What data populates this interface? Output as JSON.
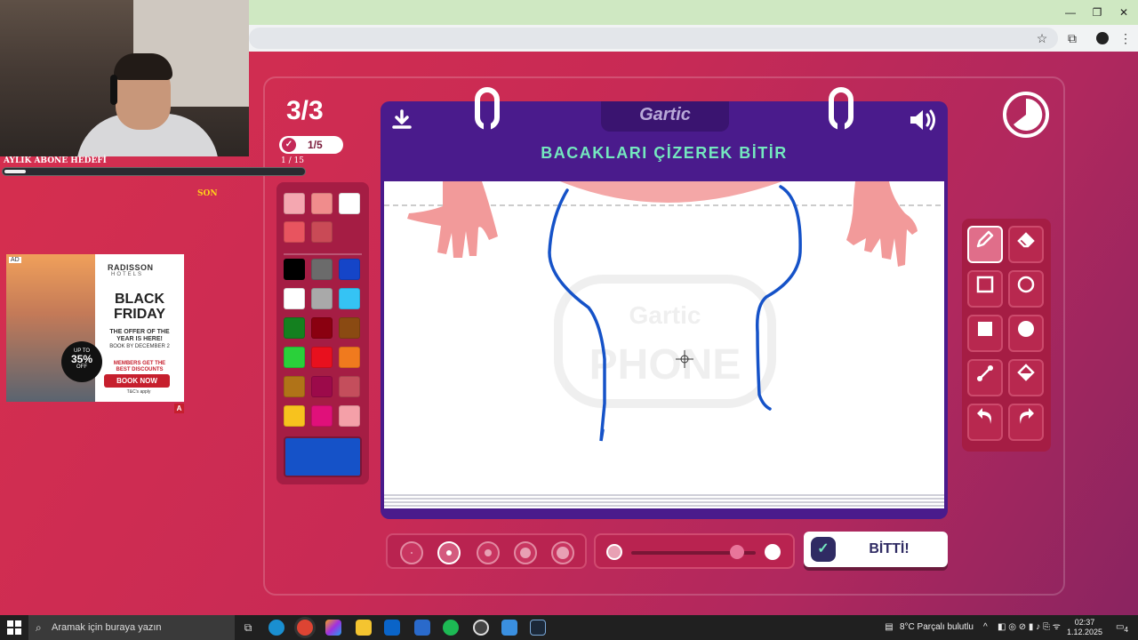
{
  "window": {
    "minimize": "—",
    "restore": "❐",
    "close": "✕"
  },
  "stream": {
    "sub_goal_label": "AYLIK ABONE HEDEFİ",
    "sub_goal_count": "1 / 15",
    "sub_goal_progress": 0.07,
    "son_label": "SON"
  },
  "ad": {
    "tag": "AD",
    "brand": "RADISSON",
    "brand_sub": "HOTELS",
    "title_line1": "BLACK",
    "title_line2": "FRIDAY",
    "offer_line1": "THE OFFER OF THE",
    "offer_line2": "YEAR IS HERE!",
    "book_by": "BOOK BY DECEMBER 2",
    "members_line1": "MEMBERS GET THE",
    "members_line2": "BEST DISCOUNTS",
    "badge_top": "UP TO",
    "badge_value": "35%",
    "badge_bottom": "OFF",
    "cta": "BOOK NOW",
    "terms": "T&C's apply",
    "corner": "A"
  },
  "game": {
    "round": "3/3",
    "sub_round": "1/5",
    "logo": "Gartic",
    "prompt": "BACAKLARI ÇİZEREK BİTİR",
    "done_label": "BİTTİ!",
    "watermark_top": "Gartic",
    "watermark_bottom": "PHONE"
  },
  "palette": {
    "colors": [
      "#f4a7b0",
      "#f08c8c",
      "#ffffff",
      "#e8545f",
      "#c94a56",
      "#000000",
      "#6b6b6b",
      "#1545c8",
      "#ffffff",
      "#a9a9a9",
      "#35c3f4",
      "#14801f",
      "#8a0010",
      "#8a4a12",
      "#2ad03a",
      "#e8101e",
      "#f07a1e",
      "#b07318",
      "#9c0a4a",
      "#c44e5c",
      "#f7c21e",
      "#e0107a",
      "#f4a0a8"
    ],
    "selected": "#1552c8"
  },
  "tools": [
    "pencil",
    "eraser",
    "rectangle-outline",
    "circle-outline",
    "rectangle-filled",
    "circle-filled",
    "line",
    "fill",
    "undo",
    "redo"
  ],
  "brush_sizes": [
    "xs",
    "s",
    "m",
    "l",
    "xl"
  ],
  "selected_size": "s",
  "opacity_level": 0.85,
  "taskbar": {
    "search_placeholder": "Aramak için buraya yazın",
    "weather": "8°C  Parçalı bulutlu",
    "time": "02:37",
    "date": "1.12.2025",
    "notifications": "4"
  },
  "colors": {
    "accent": "#4a1b8c",
    "prompt": "#74e8bf",
    "page_bg": "#c8244c"
  }
}
